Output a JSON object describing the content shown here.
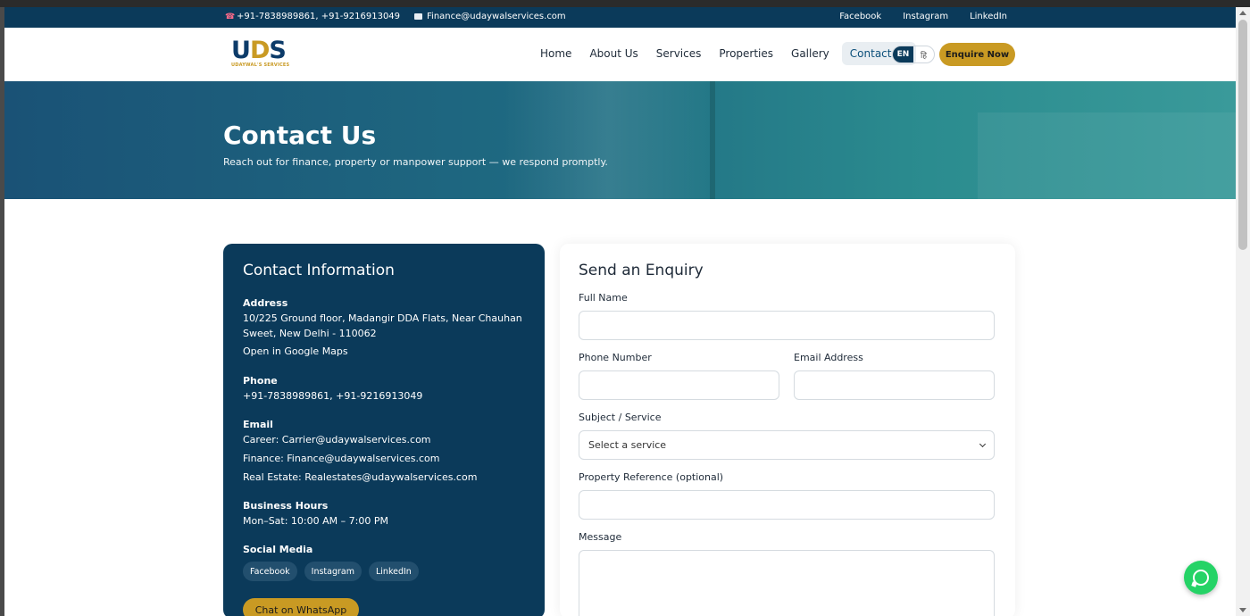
{
  "topbar": {
    "phone": "+91-7838989861, +91-9216913049",
    "email": "Finance@udaywalservices.com",
    "social": [
      "Facebook",
      "Instagram",
      "LinkedIn"
    ]
  },
  "header": {
    "logo_text": "UDS",
    "logo_sub": "UDAYWAL'S SERVICES",
    "nav": [
      "Home",
      "About Us",
      "Services",
      "Properties",
      "Gallery",
      "Contact Us"
    ],
    "active_nav": "Contact Us",
    "lang_en": "EN",
    "lang_hi": "हि",
    "cta": "Enquire Now"
  },
  "hero": {
    "title": "Contact Us",
    "subtitle": "Reach out for finance, property or manpower support — we respond promptly."
  },
  "contact_info": {
    "title": "Contact Information",
    "address_label": "Address",
    "address": "10/225 Ground floor, Madangir DDA Flats, Near Chauhan Sweet, New Delhi - 110062",
    "maps_link": "Open in Google Maps",
    "phone_label": "Phone",
    "phone": "+91-7838989861, +91-9216913049",
    "email_label": "Email",
    "emails": [
      "Career: Carrier@udaywalservices.com",
      "Finance: Finance@udaywalservices.com",
      "Real Estate: Realestates@udaywalservices.com"
    ],
    "hours_label": "Business Hours",
    "hours": "Mon–Sat: 10:00 AM – 7:00 PM",
    "social_label": "Social Media",
    "social": [
      "Facebook",
      "Instagram",
      "LinkedIn"
    ],
    "whatsapp_btn": "Chat on WhatsApp"
  },
  "form": {
    "title": "Send an Enquiry",
    "full_name_label": "Full Name",
    "phone_label": "Phone Number",
    "email_label": "Email Address",
    "subject_label": "Subject / Service",
    "subject_value": "Select a service",
    "property_label": "Property Reference (optional)",
    "message_label": "Message"
  },
  "colors": {
    "navy": "#0b3a5a",
    "gold": "#c99a23",
    "whatsapp": "#25d366"
  }
}
